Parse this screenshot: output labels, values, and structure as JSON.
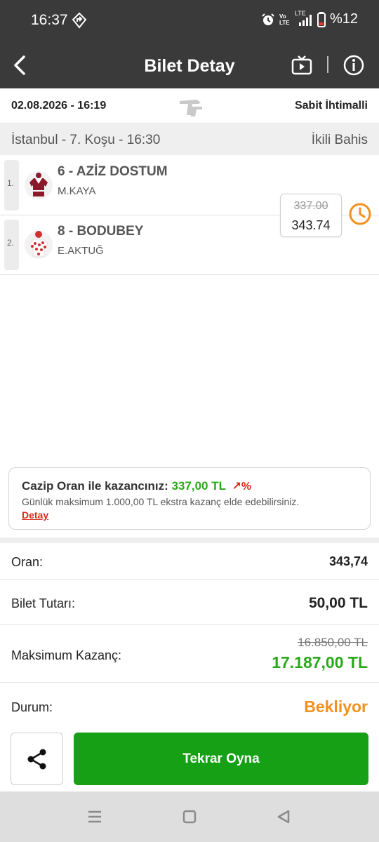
{
  "status_bar": {
    "time": "16:37",
    "volte": "Vo LTE",
    "lte": "LTE",
    "battery": "%12"
  },
  "header": {
    "title": "Bilet Detay"
  },
  "ticket": {
    "date": "02.08.2026 - 16:19",
    "bet_mode": "Sabit İhtimalli",
    "race": "İstanbul - 7. Koşu - 16:30",
    "bet_type": "İkili Bahis"
  },
  "horses": [
    {
      "position": "1.",
      "name": "6 - AZİZ DOSTUM",
      "jockey": "M.KAYA"
    },
    {
      "position": "2.",
      "name": "8 - BODUBEY",
      "jockey": "E.AKTUĞ"
    }
  ],
  "odds": {
    "old": "337.00",
    "new": "343.74"
  },
  "promo": {
    "label": "Cazip Oran ile kazancınız:",
    "amount": "337,00 TL",
    "description": "Günlük maksimum 1.000,00 TL ekstra kazanç elde edebilirsiniz.",
    "link": "Detay"
  },
  "summary": {
    "odds_label": "Oran:",
    "odds_value": "343,74",
    "amount_label": "Bilet Tutarı:",
    "amount_value": "50,00 TL",
    "max_label": "Maksimum Kazanç:",
    "max_old": "16.850,00 TL",
    "max_new": "17.187,00 TL",
    "status_label": "Durum:",
    "status_value": "Bekliyor"
  },
  "actions": {
    "replay_label": "Tekrar Oyna"
  },
  "colors": {
    "header_bg": "#3a3a3a",
    "green": "#16a016",
    "win_green": "#2aa81a",
    "pending_orange": "#f4901e",
    "promo_red": "#d62c1a"
  }
}
